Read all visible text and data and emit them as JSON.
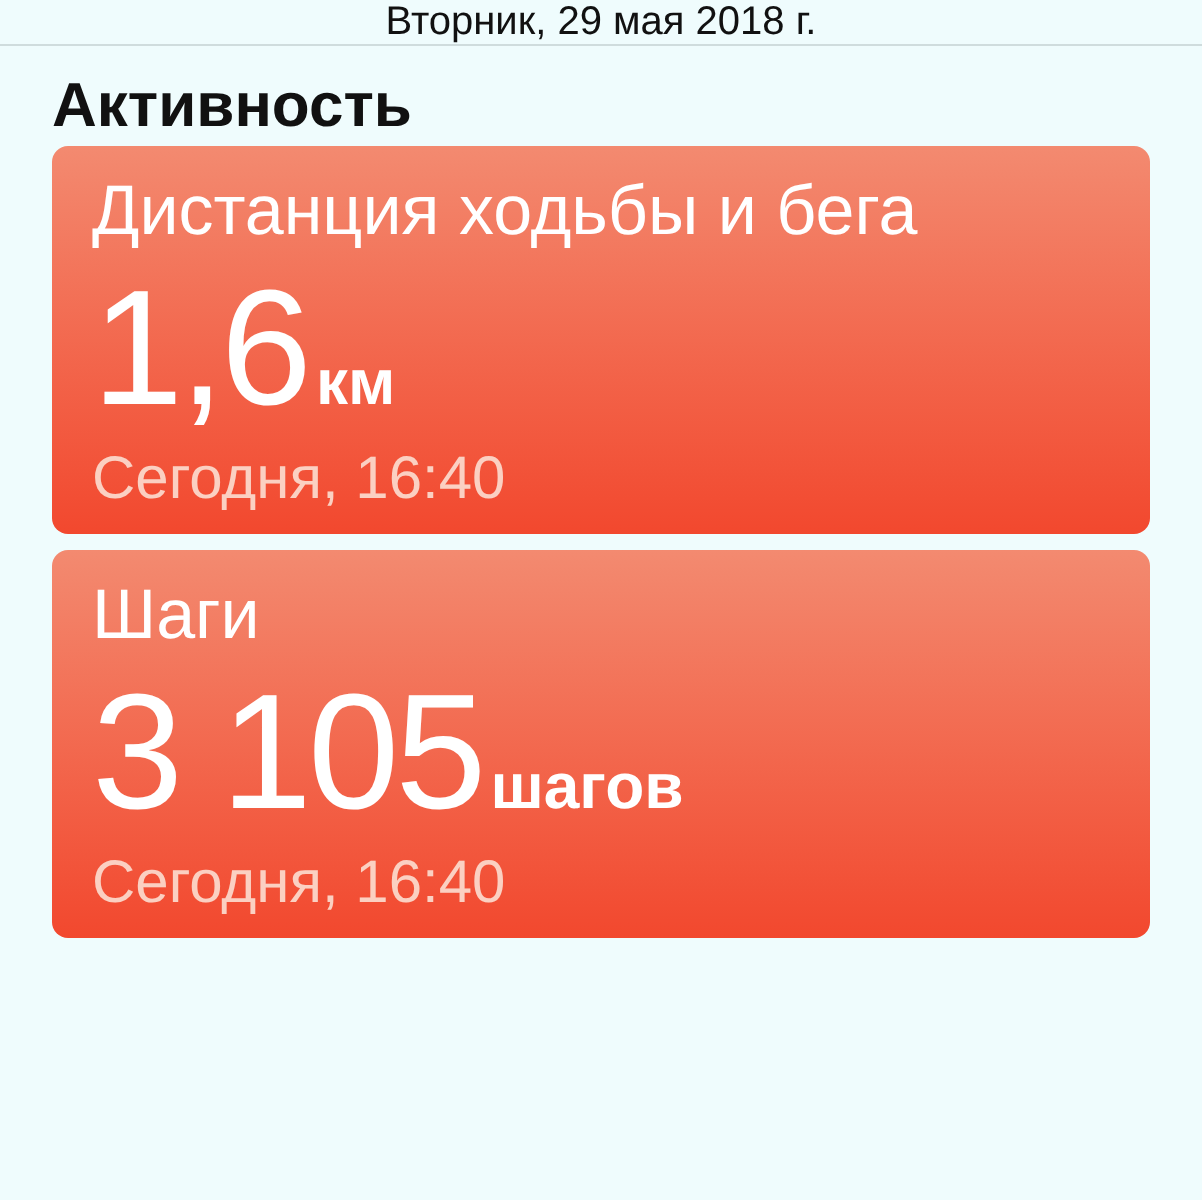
{
  "header": {
    "date": "Вторник, 29 мая 2018 г."
  },
  "section": {
    "title": "Активность"
  },
  "cards": [
    {
      "title": "Дистанция ходьбы и бега",
      "value": "1,6",
      "unit": "км",
      "time": "Сегодня, 16:40"
    },
    {
      "title": "Шаги",
      "value": "3 105",
      "unit": "шагов",
      "time": "Сегодня, 16:40"
    }
  ]
}
